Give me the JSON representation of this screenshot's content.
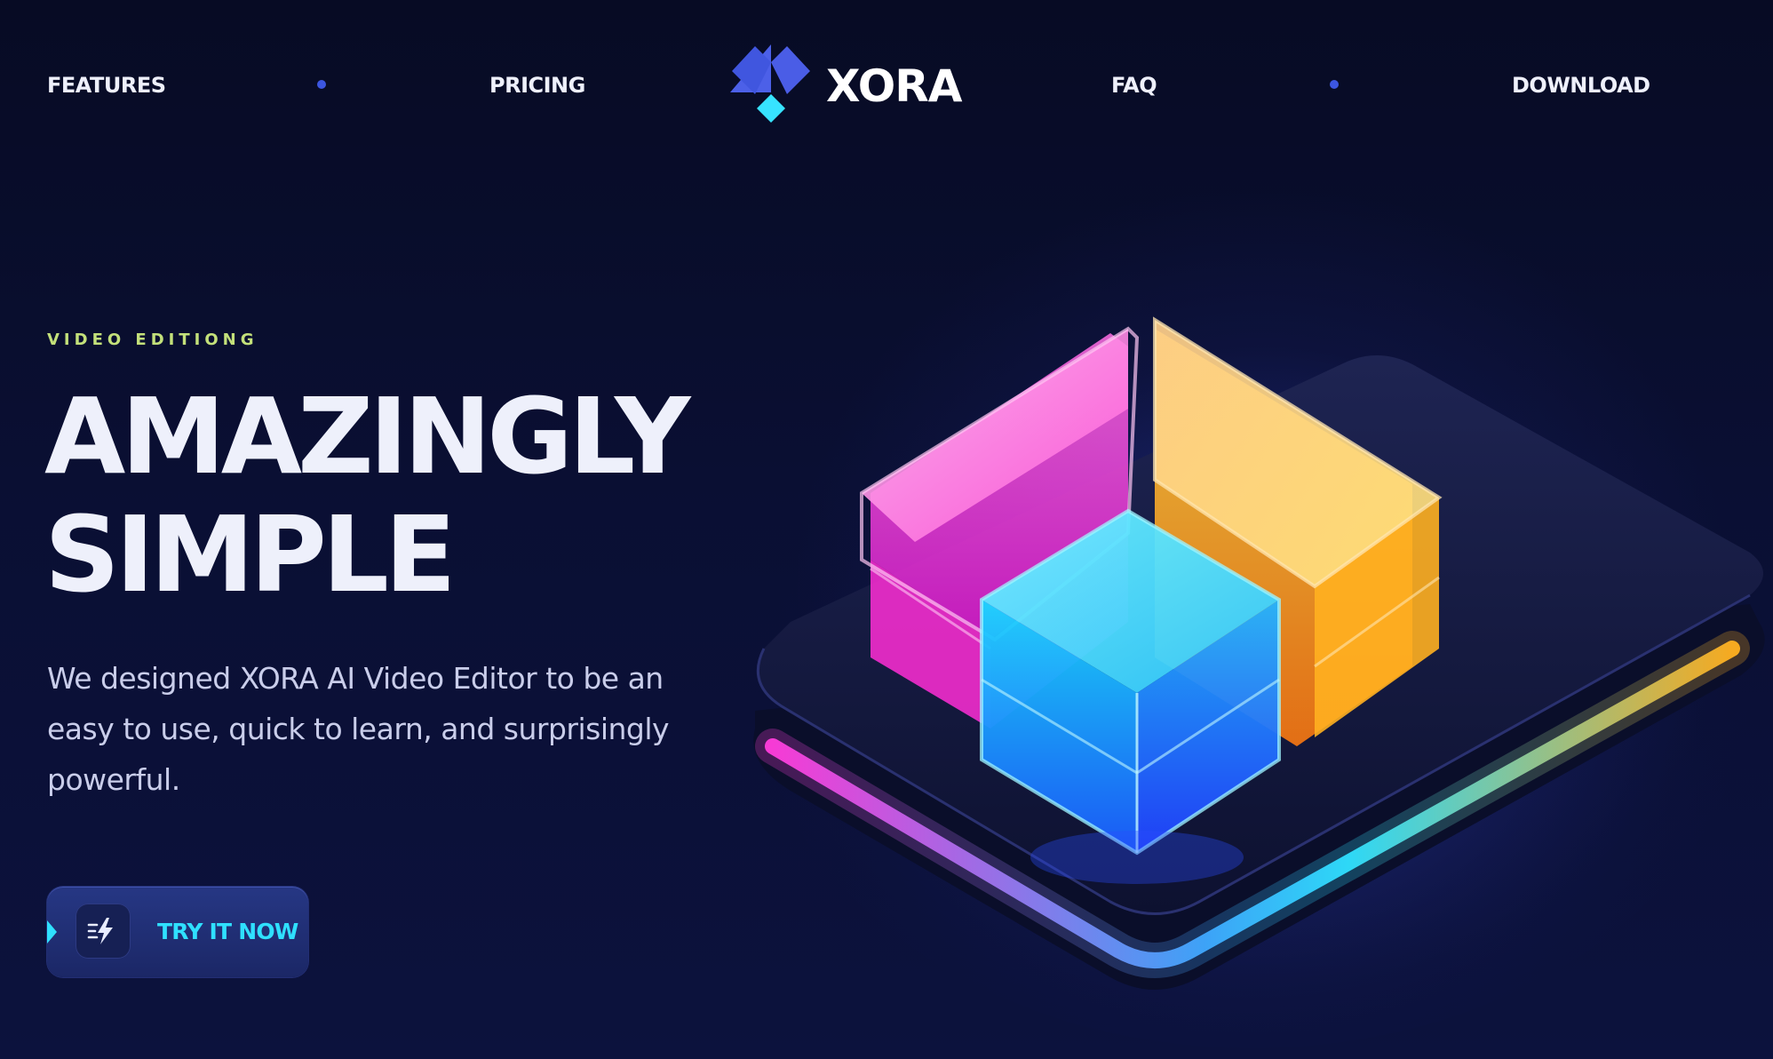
{
  "nav": {
    "links": [
      "FEATURES",
      "PRICING",
      "FAQ",
      "DOWNLOAD"
    ],
    "logo_text": "XORA"
  },
  "hero": {
    "eyebrow": "VIDEO EDITIONG",
    "headline_line1": "AMAZINGLY",
    "headline_line2": "SIMPLE",
    "description": "We designed XORA AI Video Editor to be an easy to use, quick to learn, and surprisingly powerful.",
    "cta_label": "TRY IT NOW"
  },
  "icons": {
    "logo": "xora-diamond-logo-icon",
    "cta": "lightning-speed-icon",
    "hero": "glass-blocks-illustration"
  },
  "colors": {
    "background": "#080c2a",
    "accent_blue": "#3c56e0",
    "accent_cyan": "#2fe0ff",
    "eyebrow_green": "#c3e07a",
    "text_primary": "#eef0fb",
    "text_secondary": "#c9cdea",
    "magenta": "#ff3ddc",
    "orange": "#ffb020"
  }
}
